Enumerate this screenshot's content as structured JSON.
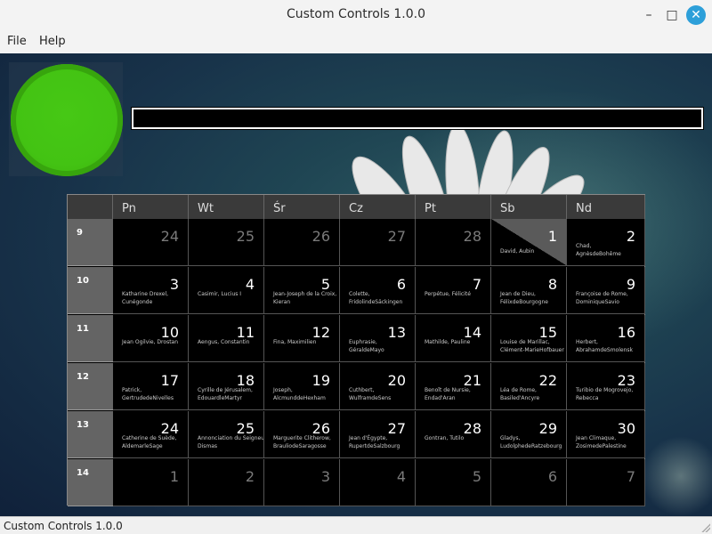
{
  "window": {
    "title": "Custom Controls 1.0.0",
    "minimize": "–",
    "maximize": "□",
    "close": "✕"
  },
  "menu": {
    "file": "File",
    "help": "Help"
  },
  "colors": {
    "led": "#43c313",
    "accent": "#2d9fd9"
  },
  "calendar": {
    "weekdays": [
      "Pn",
      "Wt",
      "Śr",
      "Cz",
      "Pt",
      "Sb",
      "Nd"
    ],
    "weeks": [
      {
        "no": "9",
        "days": [
          {
            "d": "24",
            "other": true,
            "names": ""
          },
          {
            "d": "25",
            "other": true,
            "names": ""
          },
          {
            "d": "26",
            "other": true,
            "names": ""
          },
          {
            "d": "27",
            "other": true,
            "names": ""
          },
          {
            "d": "28",
            "other": true,
            "names": ""
          },
          {
            "d": "1",
            "today": true,
            "names": "David, Aubin"
          },
          {
            "d": "2",
            "names": "Chad,\nAgnèsdeBohême"
          }
        ]
      },
      {
        "no": "10",
        "days": [
          {
            "d": "3",
            "names": "Katharine Drexel,\nCunégonde"
          },
          {
            "d": "4",
            "names": "Casimir, Lucius I"
          },
          {
            "d": "5",
            "names": "Jean-Joseph de la Croix,\nKieran"
          },
          {
            "d": "6",
            "names": "Colette,\nFridolindeSäckingen"
          },
          {
            "d": "7",
            "names": "Perpétue, Félicité"
          },
          {
            "d": "8",
            "names": "Jean de Dieu,\nFélixdeBourgogne"
          },
          {
            "d": "9",
            "names": "Françoise de Rome,\nDominiqueSavio"
          }
        ]
      },
      {
        "no": "11",
        "days": [
          {
            "d": "10",
            "names": "Jean Ogilvie, Drostan"
          },
          {
            "d": "11",
            "names": "Aengus, Constantin"
          },
          {
            "d": "12",
            "names": "Fina, Maximilien"
          },
          {
            "d": "13",
            "names": "Euphrasie,\nGéraldeMayo"
          },
          {
            "d": "14",
            "names": "Mathilde, Pauline"
          },
          {
            "d": "15",
            "names": "Louise de Marillac,\nClément-MarieHofbauer"
          },
          {
            "d": "16",
            "names": "Herbert,\nAbrahamdeSmolensk"
          }
        ]
      },
      {
        "no": "12",
        "days": [
          {
            "d": "17",
            "names": "Patrick,\nGertrudedeNivelles"
          },
          {
            "d": "18",
            "names": "Cyrille de Jérusalem,\nEdouardleMartyr"
          },
          {
            "d": "19",
            "names": "Joseph,\nAlcmunddeHexham"
          },
          {
            "d": "20",
            "names": "Cuthbert,\nWulframdeSens"
          },
          {
            "d": "21",
            "names": "Benoît de Nursie,\nEndad'Aran"
          },
          {
            "d": "22",
            "names": "Léa de Rome,\nBasiled'Ancyre"
          },
          {
            "d": "23",
            "names": "Turibio de Mogrovejo,\nRebecca"
          }
        ]
      },
      {
        "no": "13",
        "days": [
          {
            "d": "24",
            "names": "Catherine de Suède,\nAldemarleSage"
          },
          {
            "d": "25",
            "names": "Annonciation du Seigneur,\nDismas"
          },
          {
            "d": "26",
            "names": "Marguerite Clitherow,\nBrauliodeSaragosse"
          },
          {
            "d": "27",
            "names": "Jean d'Égypte,\nRupertdeSalzbourg"
          },
          {
            "d": "28",
            "names": "Gontran, Tutilo"
          },
          {
            "d": "29",
            "names": "Gladys,\nLudolphedeRatzebourg"
          },
          {
            "d": "30",
            "names": "Jean Climaque,\nZosimedePalestine"
          }
        ]
      },
      {
        "no": "14",
        "days": [
          {
            "d": "1",
            "other": true,
            "names": ""
          },
          {
            "d": "2",
            "other": true,
            "names": ""
          },
          {
            "d": "3",
            "other": true,
            "names": ""
          },
          {
            "d": "4",
            "other": true,
            "names": ""
          },
          {
            "d": "5",
            "other": true,
            "names": ""
          },
          {
            "d": "6",
            "other": true,
            "names": ""
          },
          {
            "d": "7",
            "other": true,
            "names": ""
          }
        ]
      }
    ]
  },
  "statusbar": {
    "text": "Custom Controls 1.0.0"
  }
}
